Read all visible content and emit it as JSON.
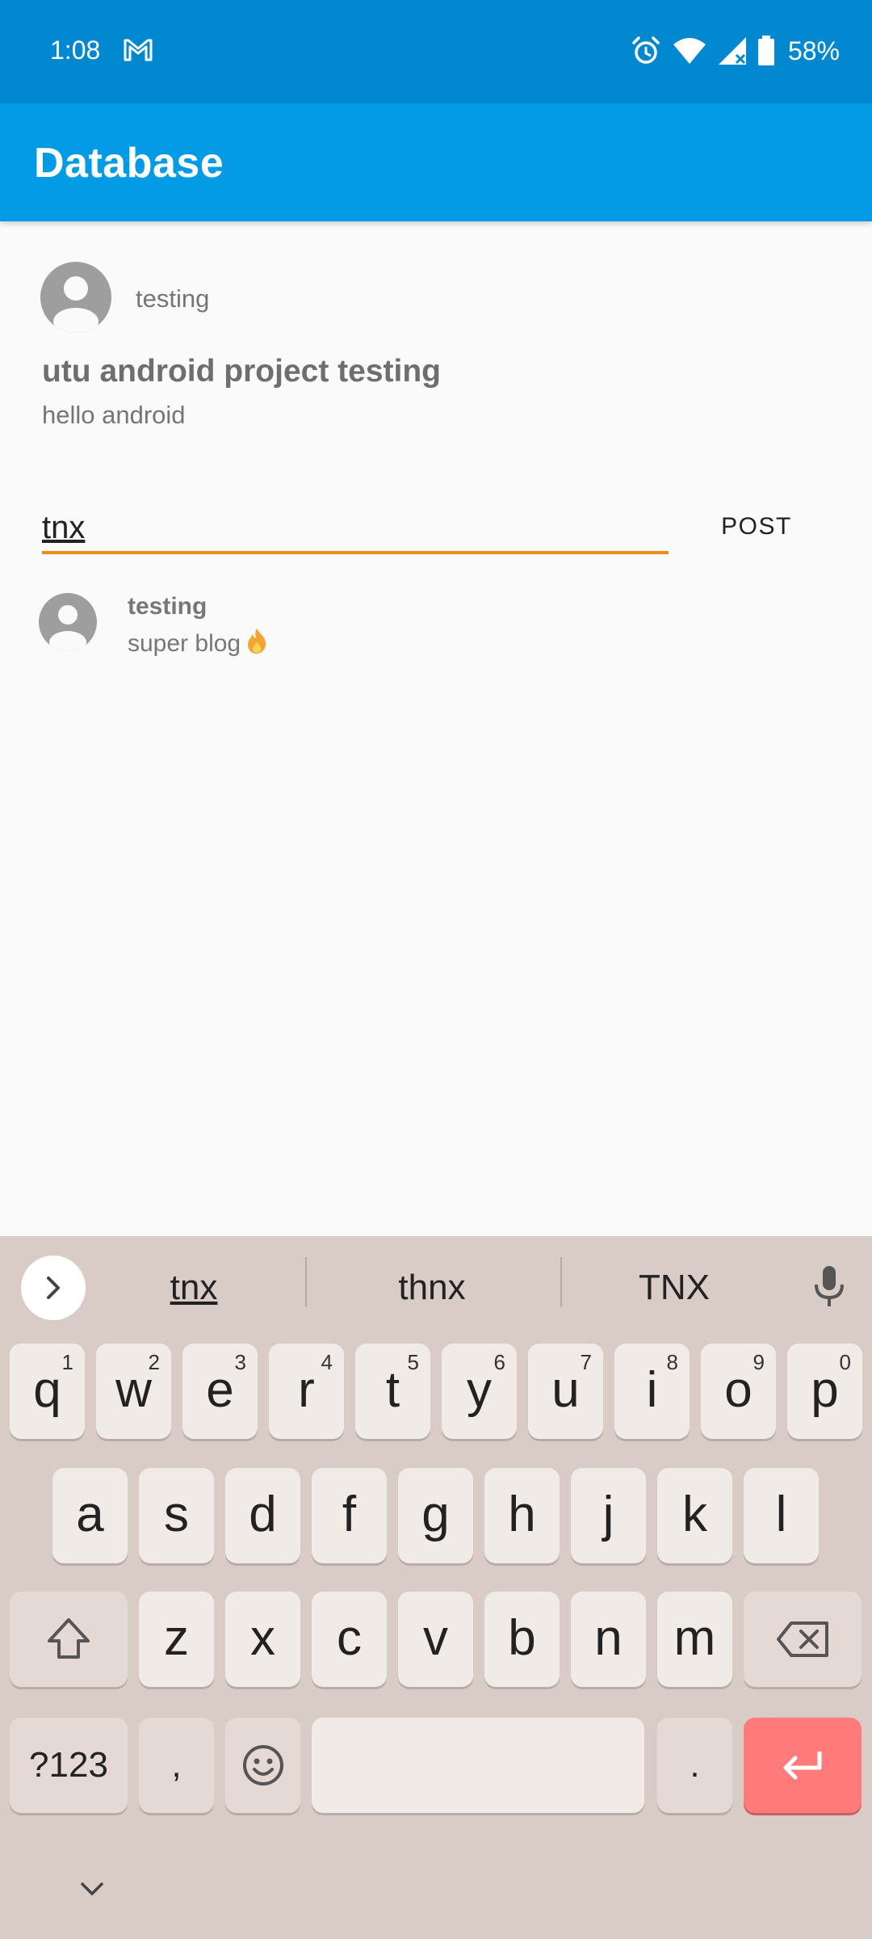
{
  "status_bar": {
    "time": "1:08",
    "battery": "58%",
    "icons": [
      "gmail-icon",
      "alarm-icon",
      "wifi-icon",
      "signal-icon",
      "battery-icon"
    ]
  },
  "app_bar": {
    "title": "Database"
  },
  "post": {
    "author": "testing",
    "title": "utu android project testing",
    "body": "hello android"
  },
  "comment_input": {
    "value": "tnx"
  },
  "post_button": {
    "label": "POST"
  },
  "comments": [
    {
      "author": "testing",
      "text": "super blog"
    }
  ],
  "keyboard": {
    "suggestions": [
      "tnx",
      "thnx",
      "TNX"
    ],
    "row1": [
      {
        "k": "q",
        "h": "1"
      },
      {
        "k": "w",
        "h": "2"
      },
      {
        "k": "e",
        "h": "3"
      },
      {
        "k": "r",
        "h": "4"
      },
      {
        "k": "t",
        "h": "5"
      },
      {
        "k": "y",
        "h": "6"
      },
      {
        "k": "u",
        "h": "7"
      },
      {
        "k": "i",
        "h": "8"
      },
      {
        "k": "o",
        "h": "9"
      },
      {
        "k": "p",
        "h": "0"
      }
    ],
    "row2": [
      "a",
      "s",
      "d",
      "f",
      "g",
      "h",
      "j",
      "k",
      "l"
    ],
    "row3": [
      "z",
      "x",
      "c",
      "v",
      "b",
      "n",
      "m"
    ],
    "symbols_label": "?123",
    "comma": ",",
    "period": "."
  },
  "colors": {
    "status_bar": "#0288d1",
    "app_bar": "#039be5",
    "input_underline": "#f08c12",
    "enter_key": "#ff7b7b",
    "keyboard_bg": "#d9ccc6"
  }
}
